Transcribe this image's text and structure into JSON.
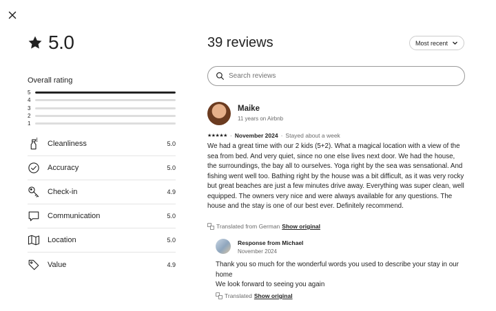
{
  "overall": {
    "score": "5.0",
    "label": "Overall rating",
    "distribution": [
      {
        "star": "5",
        "fraction": 1.0
      },
      {
        "star": "4",
        "fraction": 0.0
      },
      {
        "star": "3",
        "fraction": 0.0
      },
      {
        "star": "2",
        "fraction": 0.0
      },
      {
        "star": "1",
        "fraction": 0.0
      }
    ]
  },
  "categories": [
    {
      "name": "Cleanliness",
      "value": "5.0",
      "icon": "spray-bottle-icon"
    },
    {
      "name": "Accuracy",
      "value": "5.0",
      "icon": "check-circle-icon"
    },
    {
      "name": "Check-in",
      "value": "4.9",
      "icon": "key-icon"
    },
    {
      "name": "Communication",
      "value": "5.0",
      "icon": "chat-bubble-icon"
    },
    {
      "name": "Location",
      "value": "5.0",
      "icon": "map-icon"
    },
    {
      "name": "Value",
      "value": "4.9",
      "icon": "tag-icon"
    }
  ],
  "reviews_header": {
    "title": "39 reviews",
    "sort_label": "Most recent"
  },
  "search": {
    "placeholder": "Search reviews",
    "value": ""
  },
  "review": {
    "name": "Maike",
    "tenure": "11 years on Airbnb",
    "stars": "★★★★★",
    "date": "November 2024",
    "separator": "·",
    "stay": "Stayed about a week",
    "text": "We had a great time with our 2 kids (5+2). What a magical location with a view of the sea from bed. And very quiet, since no one else lives next door. We had the house, the surroundings, the bay all to ourselves. Yoga right by the sea was sensational. And fishing went well too. Bathing right by the house was a bit difficult, as it was very rocky but great beaches are just a few minutes drive away. Everything was super clean, well equipped. The owners very nice and were always available for any questions. The house and the stay is one of our best ever. Definitely recommend.",
    "translated_note": "Translated from German",
    "show_original": "Show original"
  },
  "response": {
    "title": "Response from Michael",
    "date": "November 2024",
    "line1": "Thank you so much for the wonderful words you used to describe your stay in our home",
    "line2": "We look forward to seeing you again",
    "translated_note": "Translated",
    "show_original": "Show original"
  }
}
